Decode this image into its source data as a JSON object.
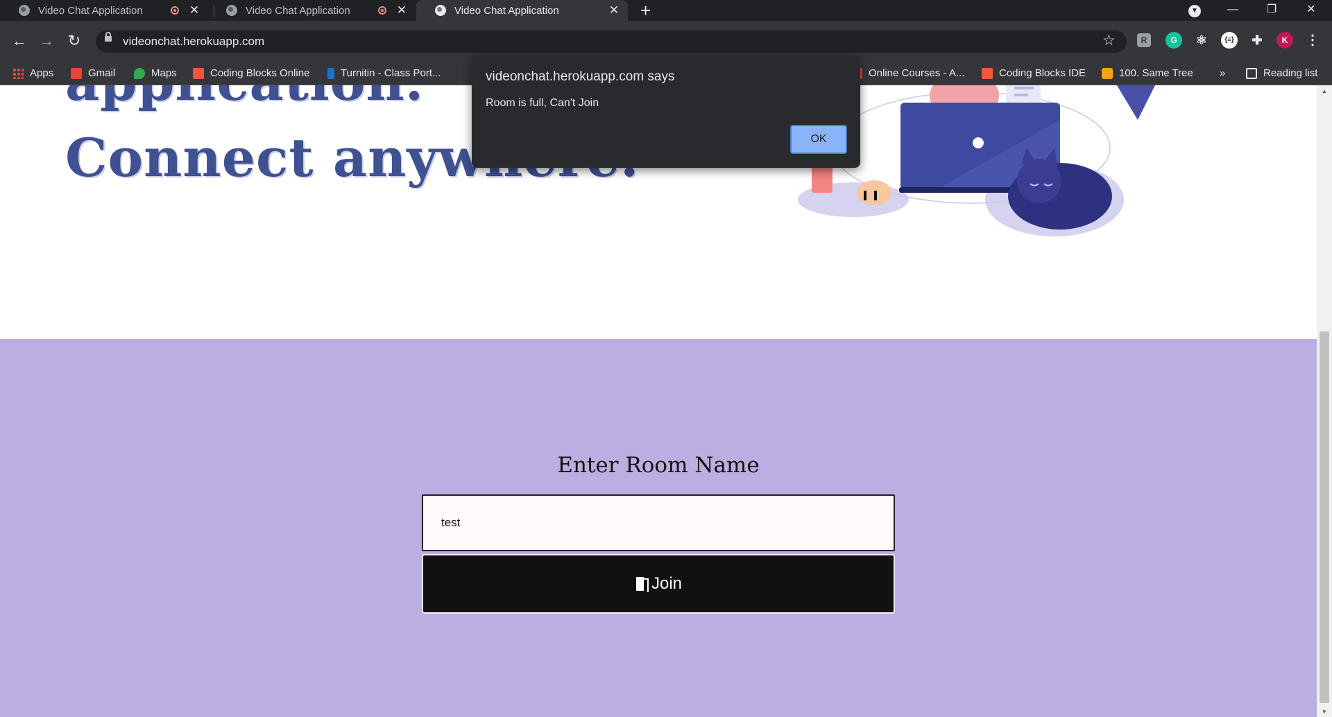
{
  "browser": {
    "tabs": [
      {
        "title": "Video Chat Application",
        "recording": true,
        "active": false
      },
      {
        "title": "Video Chat Application",
        "recording": true,
        "active": false
      },
      {
        "title": "Video Chat Application",
        "recording": false,
        "active": true
      }
    ],
    "new_tab_icon": "plus-icon",
    "window_controls": {
      "minimize": "—",
      "restore": "❐",
      "close": "✕"
    },
    "nav": {
      "back": "←",
      "forward": "→",
      "reload": "↻"
    },
    "url": "videonchat.herokuapp.com",
    "bookmarks": [
      {
        "label": "Apps",
        "icon": "apps-grid-icon"
      },
      {
        "label": "Gmail",
        "icon": "gmail-icon"
      },
      {
        "label": "Maps",
        "icon": "maps-icon"
      },
      {
        "label": "Coding Blocks Online",
        "icon": "coding-blocks-icon"
      },
      {
        "label": "Turnitin - Class Port...",
        "icon": "turnitin-icon"
      },
      {
        "label": "Online Courses - A...",
        "icon": "courses-icon"
      },
      {
        "label": "Coding Blocks IDE",
        "icon": "coding-blocks-icon"
      },
      {
        "label": "100. Same Tree",
        "icon": "leetcode-icon"
      }
    ],
    "bookmarks_overflow": "»",
    "reading_list": "Reading list",
    "profile_initial": "K"
  },
  "hero": {
    "line1": "application.",
    "line2": "Connect anywhere."
  },
  "join": {
    "heading": "Enter Room Name",
    "room_value": "test",
    "button_label": "Join"
  },
  "alert": {
    "title": "videonchat.herokuapp.com says",
    "message": "Room is full, Can't Join",
    "ok_label": "OK"
  },
  "colors": {
    "join_bg": "#bdaee2",
    "hero_text": "#3f5190",
    "ok_button": "#8ab4f8"
  }
}
